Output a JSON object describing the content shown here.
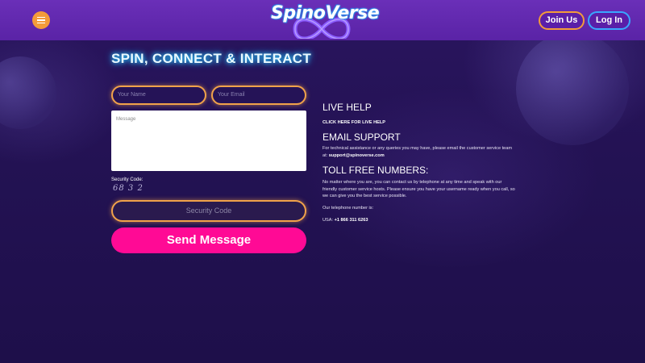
{
  "header": {
    "logo_text": "SpinoVerse",
    "join_label": "Join Us",
    "login_label": "Log In"
  },
  "main": {
    "title": "SPIN, CONNECT & INTERACT",
    "form": {
      "name_placeholder": "Your Name",
      "email_placeholder": "Your Email",
      "message_placeholder": "Message",
      "security_label": "Security Code:",
      "captcha": "68 3 2",
      "security_placeholder": "Security Code",
      "send_label": "Send Message"
    }
  },
  "help": {
    "live_help_heading": "LIVE HELP",
    "live_help_link": "CLICK HERE FOR LIVE HELP",
    "email_heading": "EMAIL SUPPORT",
    "email_text": "For technical assistance or any queries you may have, please email the customer service team at:",
    "email_address": "support@spinoverse.com",
    "toll_heading": "TOLL FREE NUMBERS:",
    "toll_text": "No matter where you are, you can contact us by telephone at any time and speak with our friendly customer service hosts. Please ensure you have your username ready when you call, so we can give you the best service possible.",
    "phone_intro": "Our telephone number is:",
    "phone_prefix": "USA:",
    "phone_number": "+1 866 311 6263"
  },
  "colors": {
    "header_bg": "#5a23a6",
    "accent_orange": "#f39b3a",
    "accent_blue": "#3aa6ff",
    "send_pink": "#ff0a95",
    "page_bg": "#1f0f4e"
  },
  "icons": {
    "menu": "hamburger-icon"
  }
}
